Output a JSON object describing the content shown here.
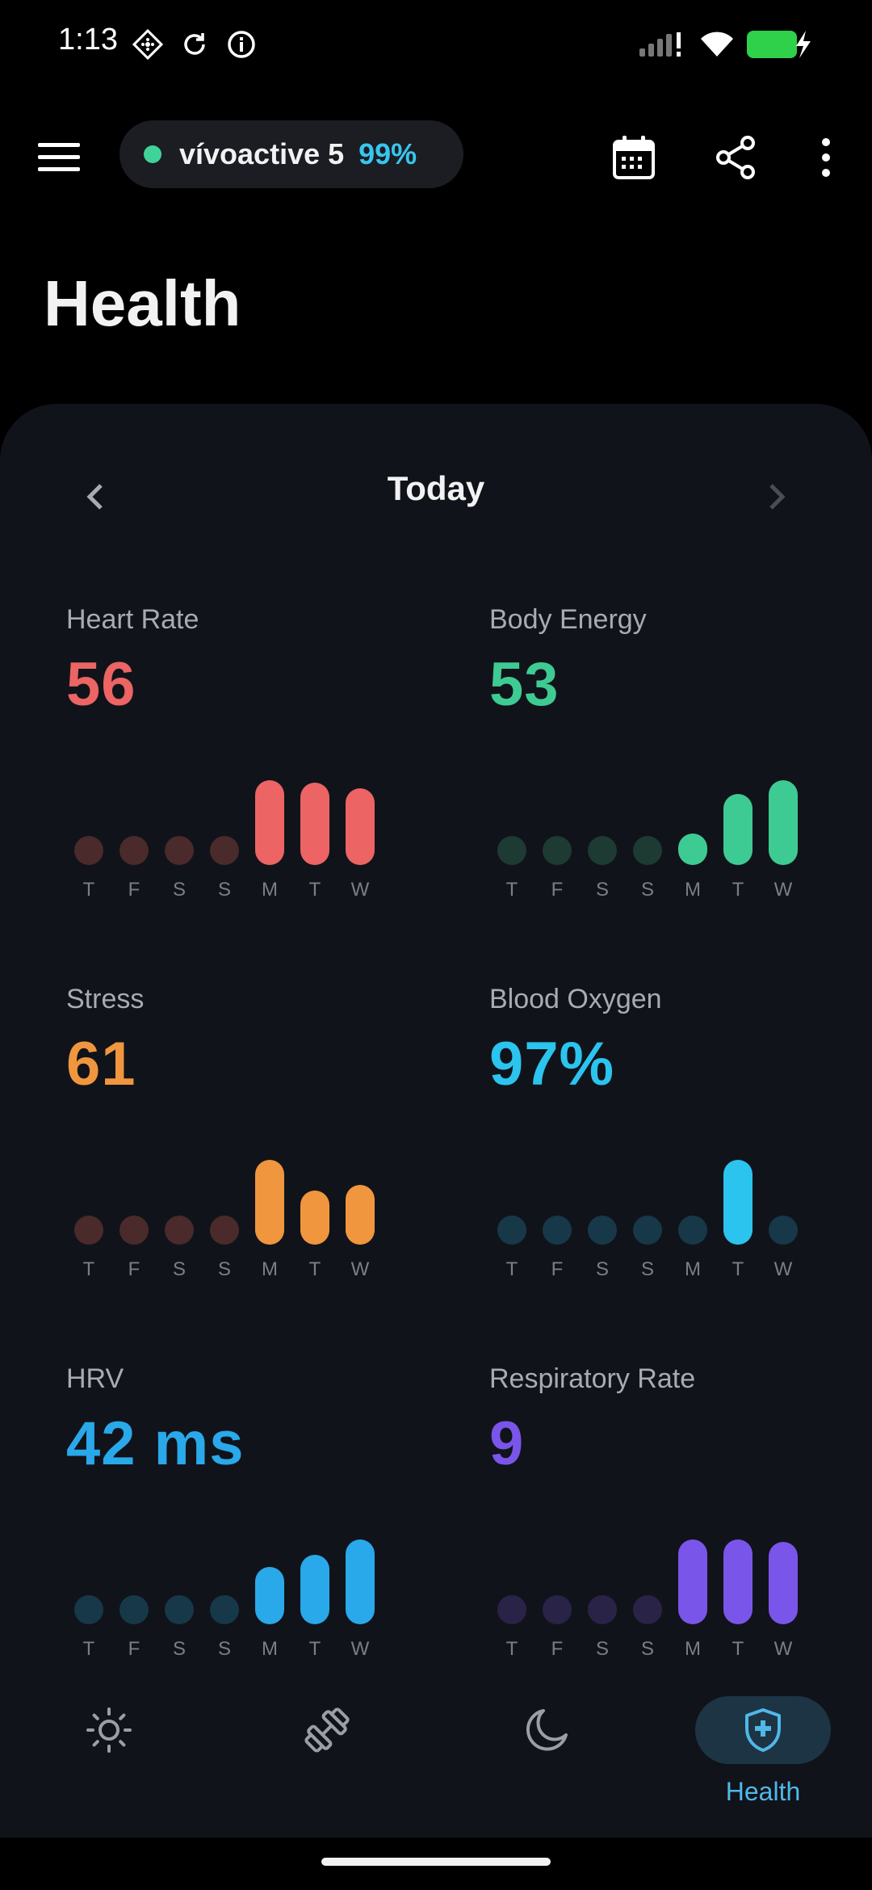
{
  "status_bar": {
    "time": "1:13",
    "icons": [
      "navigation-diamond-icon",
      "sync-icon",
      "info-icon",
      "signal-icon",
      "wifi-icon",
      "battery-charging-icon"
    ],
    "battery_color": "#2fd04a"
  },
  "header": {
    "device_name": "vívoactive 5",
    "battery": "99%",
    "status_dot_color": "#3fd39a",
    "icons": [
      "menu-icon",
      "calendar-icon",
      "share-icon",
      "more-vert-icon"
    ]
  },
  "page": {
    "title": "Health"
  },
  "date_nav": {
    "title": "Today",
    "prev_icon": "chevron-left-icon",
    "next_icon": "chevron-right-icon"
  },
  "metrics": [
    {
      "label": "Heart Rate",
      "value": "56",
      "color": "#ec6464",
      "dim_color": "#4a2a2a",
      "days": [
        "T",
        "F",
        "S",
        "S",
        "M",
        "T",
        "W"
      ],
      "levels": [
        0,
        0,
        0,
        0,
        1.0,
        0.95,
        0.85
      ]
    },
    {
      "label": "Body Energy",
      "value": "53",
      "color": "#3ecb93",
      "dim_color": "#1d3a33",
      "days": [
        "T",
        "F",
        "S",
        "S",
        "M",
        "T",
        "W"
      ],
      "levels": [
        0,
        0,
        0,
        0,
        0.05,
        0.75,
        1.0
      ]
    },
    {
      "label": "Stress",
      "value": "61",
      "color": "#f0963e",
      "dim_color": "#4a2a2a",
      "days": [
        "T",
        "F",
        "S",
        "S",
        "M",
        "T",
        "W"
      ],
      "levels": [
        0,
        0,
        0,
        0,
        1.0,
        0.45,
        0.55
      ]
    },
    {
      "label": "Blood Oxygen",
      "value": "97%",
      "color": "#2bc4ee",
      "dim_color": "#173848",
      "days": [
        "T",
        "F",
        "S",
        "S",
        "M",
        "T",
        "W"
      ],
      "levels": [
        0,
        0,
        0,
        0,
        0,
        1.0,
        0
      ]
    },
    {
      "label": "HRV",
      "value": "42 ms",
      "color": "#29a8ea",
      "dim_color": "#173848",
      "days": [
        "T",
        "F",
        "S",
        "S",
        "M",
        "T",
        "W"
      ],
      "levels": [
        0,
        0,
        0,
        0,
        0.5,
        0.72,
        1.0
      ]
    },
    {
      "label": "Respiratory Rate",
      "value": "9",
      "color": "#7a55ea",
      "dim_color": "#2a2348",
      "days": [
        "T",
        "F",
        "S",
        "S",
        "M",
        "T",
        "W"
      ],
      "levels": [
        0,
        0,
        0,
        0,
        1.0,
        1.0,
        0.95
      ]
    }
  ],
  "bottom_nav": {
    "items": [
      {
        "id": "my-day",
        "icon": "sun-icon",
        "label": ""
      },
      {
        "id": "fitness",
        "icon": "dumbbell-icon",
        "label": ""
      },
      {
        "id": "sleep",
        "icon": "moon-icon",
        "label": ""
      },
      {
        "id": "health",
        "icon": "health-shield-icon",
        "label": "Health",
        "active": true
      }
    ],
    "active_color": "#4fb8e8"
  }
}
